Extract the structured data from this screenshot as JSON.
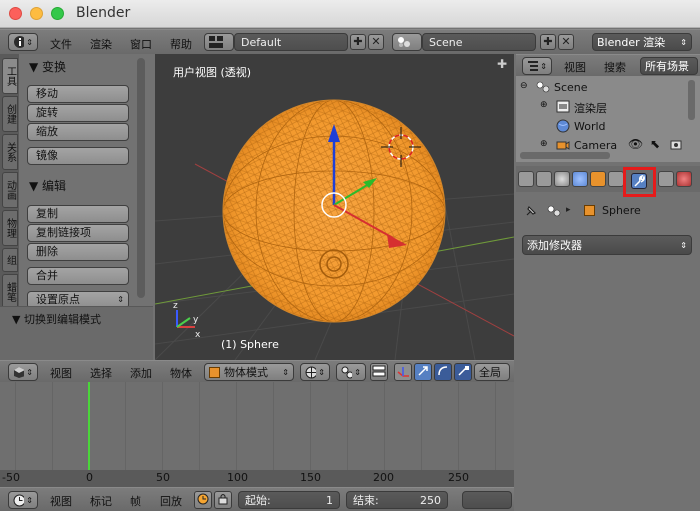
{
  "window": {
    "title": "Blender"
  },
  "topbar": {
    "menus": [
      "文件",
      "渲染",
      "窗口",
      "帮助"
    ],
    "layout": "Default",
    "scene": "Scene",
    "engine": "Blender 渲染"
  },
  "toolshelf": {
    "tabs": [
      "工具",
      "创建",
      "关系",
      "动画",
      "物理",
      "组",
      "蜡笔"
    ],
    "transform": {
      "title": "▼ 变换",
      "buttons": [
        "移动",
        "旋转",
        "缩放",
        "镜像"
      ]
    },
    "edit": {
      "title": "▼ 编辑",
      "buttons": [
        "复制",
        "复制链接项",
        "删除",
        "合并",
        "设置原点"
      ]
    },
    "last_op": "▼ 切换到编辑模式"
  },
  "viewport": {
    "label": "用户视图 (透视)",
    "object": "(1) Sphere",
    "header": {
      "view": "视图",
      "select": "选择",
      "add": "添加",
      "object": "物体",
      "mode": "物体模式",
      "global": "全局"
    }
  },
  "timeline": {
    "ticks": [
      "-50",
      "0",
      "50",
      "100",
      "150",
      "200",
      "250"
    ],
    "header": {
      "view": "视图",
      "marker": "标记",
      "frame": "帧",
      "playback": "回放",
      "start_label": "起始:",
      "start": "1",
      "end_label": "结束:",
      "end": "250"
    },
    "current_frame": 0
  },
  "outliner": {
    "view": "视图",
    "search": "搜索",
    "filter": "所有场景",
    "items": [
      "Scene",
      "渲染层",
      "World",
      "Camera"
    ]
  },
  "properties": {
    "object": "Sphere",
    "add_modifier": "添加修改器"
  },
  "colors": {
    "sphere": "#f7a33f",
    "highlight": "#e51b1b",
    "tab_active": "#5680c2"
  }
}
